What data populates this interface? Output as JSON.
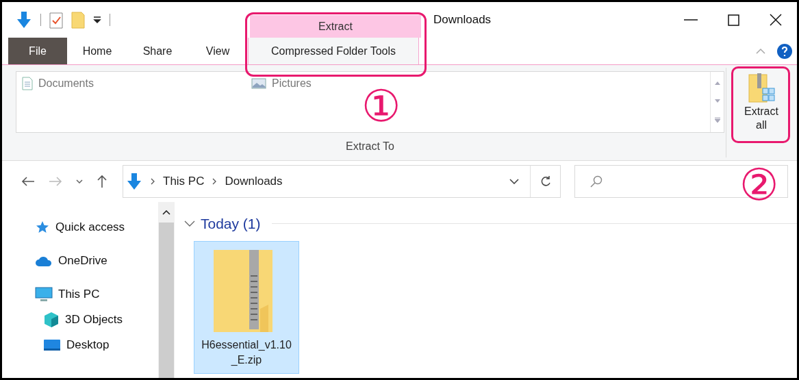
{
  "window": {
    "title": "Downloads"
  },
  "ribbon": {
    "context_tab": "Extract",
    "tabs": [
      {
        "label": "File",
        "kind": "file",
        "selected": false
      },
      {
        "label": "Home",
        "kind": "tab",
        "selected": false
      },
      {
        "label": "Share",
        "kind": "tab",
        "selected": false
      },
      {
        "label": "View",
        "kind": "tab",
        "selected": false
      },
      {
        "label": "Compressed Folder Tools",
        "kind": "context",
        "selected": true
      }
    ],
    "gallery": [
      {
        "label": "Documents",
        "kind": "document"
      },
      {
        "label": "Pictures",
        "kind": "picture"
      }
    ],
    "group_label": "Extract To",
    "big_button": "Extract all"
  },
  "address_bar": {
    "breadcrumbs": [
      "This PC",
      "Downloads"
    ]
  },
  "sidebar": {
    "items": [
      {
        "label": "Quick access",
        "kind": "star"
      },
      {
        "label": "OneDrive",
        "kind": "cloud"
      },
      {
        "label": "This PC",
        "kind": "pc",
        "children": [
          {
            "label": "3D Objects",
            "kind": "cube"
          },
          {
            "label": "Desktop",
            "kind": "desktop"
          }
        ]
      }
    ]
  },
  "content": {
    "group": {
      "label": "Today (1)",
      "expanded": true
    },
    "files": [
      {
        "name": "H6essential_v1.10_E.zip",
        "selected": true
      }
    ]
  },
  "callouts": [
    {
      "label": "①"
    },
    {
      "label": "②"
    }
  ]
}
